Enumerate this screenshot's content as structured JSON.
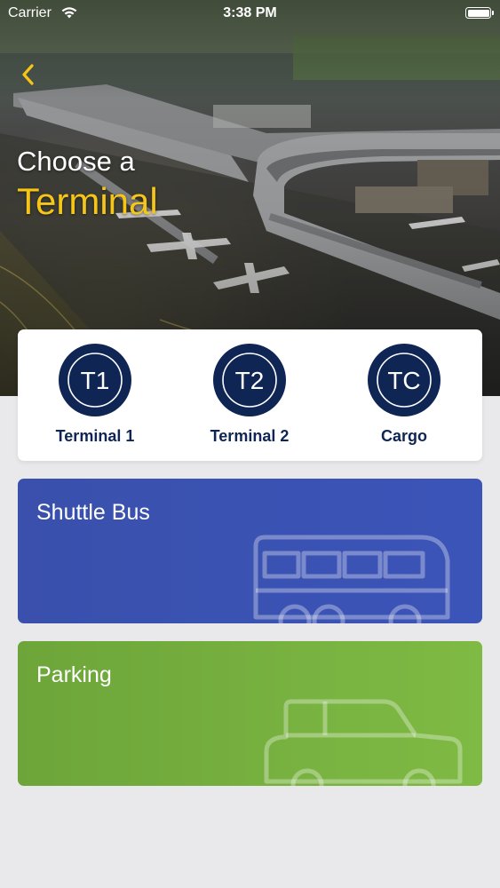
{
  "status_bar": {
    "carrier": "Carrier",
    "time": "3:38 PM"
  },
  "header": {
    "title_line1": "Choose a",
    "title_line2": "Terminal"
  },
  "terminals": [
    {
      "code": "T1",
      "label": "Terminal 1"
    },
    {
      "code": "T2",
      "label": "Terminal 2"
    },
    {
      "code": "TC",
      "label": "Cargo"
    }
  ],
  "services": {
    "shuttle": {
      "label": "Shuttle Bus",
      "icon": "bus-icon"
    },
    "parking": {
      "label": "Parking",
      "icon": "car-icon"
    }
  },
  "colors": {
    "accent": "#f5c518",
    "navy": "#0f2554",
    "shuttle_bg": "#3b52b4",
    "parking_bg": "#77b03f",
    "background": "#e9e9ec"
  }
}
